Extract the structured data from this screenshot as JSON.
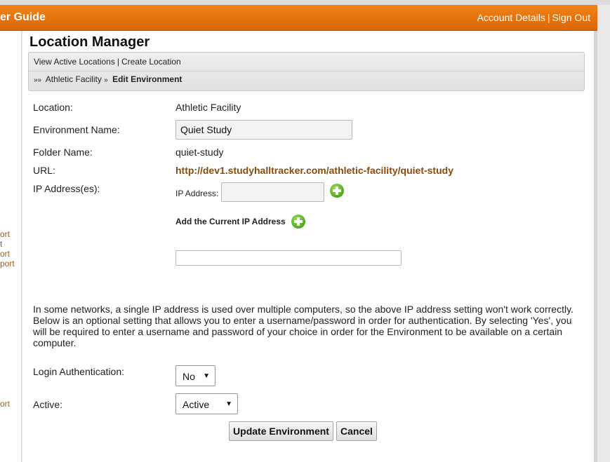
{
  "header": {
    "title": "er Guide",
    "account_details": "Account Details",
    "separator": "|",
    "sign_out": "Sign Out"
  },
  "sidebar": {
    "links": [
      "ort",
      "t",
      "ort",
      "port",
      "ort"
    ]
  },
  "page": {
    "title": "Location Manager"
  },
  "nav": {
    "view_active": "View Active Locations",
    "separator": "|",
    "create": "Create Location"
  },
  "breadcrumb": {
    "arrows": "»»",
    "parent": "Athletic Facility",
    "arrow": "»",
    "current": "Edit Environment"
  },
  "form": {
    "location_label": "Location:",
    "location_value": "Athletic Facility",
    "env_name_label": "Environment Name:",
    "env_name_value": "Quiet Study",
    "folder_label": "Folder Name:",
    "folder_value": "quiet-study",
    "url_label": "URL:",
    "url_value": "http://dev1.studyhalltracker.com/athletic-facility/quiet-study",
    "ip_label": "IP Address(es):",
    "ip_field_label": "IP Address:",
    "ip_value": "",
    "add_current_ip": "Add the Current IP Address",
    "ip_list_value": "",
    "note": "In some networks, a single IP address is used over multiple computers, so the above IP address setting won't work correctly. Below is an optional setting that allows you to enter a username/password in order for authentication. By selecting 'Yes', you will be required to enter a username and password of your choice in order for the Environment to be available on a certain computer.",
    "login_auth_label": "Login Authentication:",
    "login_auth_value": "No",
    "active_label": "Active:",
    "active_value": "Active",
    "update_button": "Update Environment",
    "cancel_button": "Cancel"
  },
  "colors": {
    "header": "#e5730f",
    "link": "#8a4a0a",
    "plus_icon": "#4caa1a"
  }
}
